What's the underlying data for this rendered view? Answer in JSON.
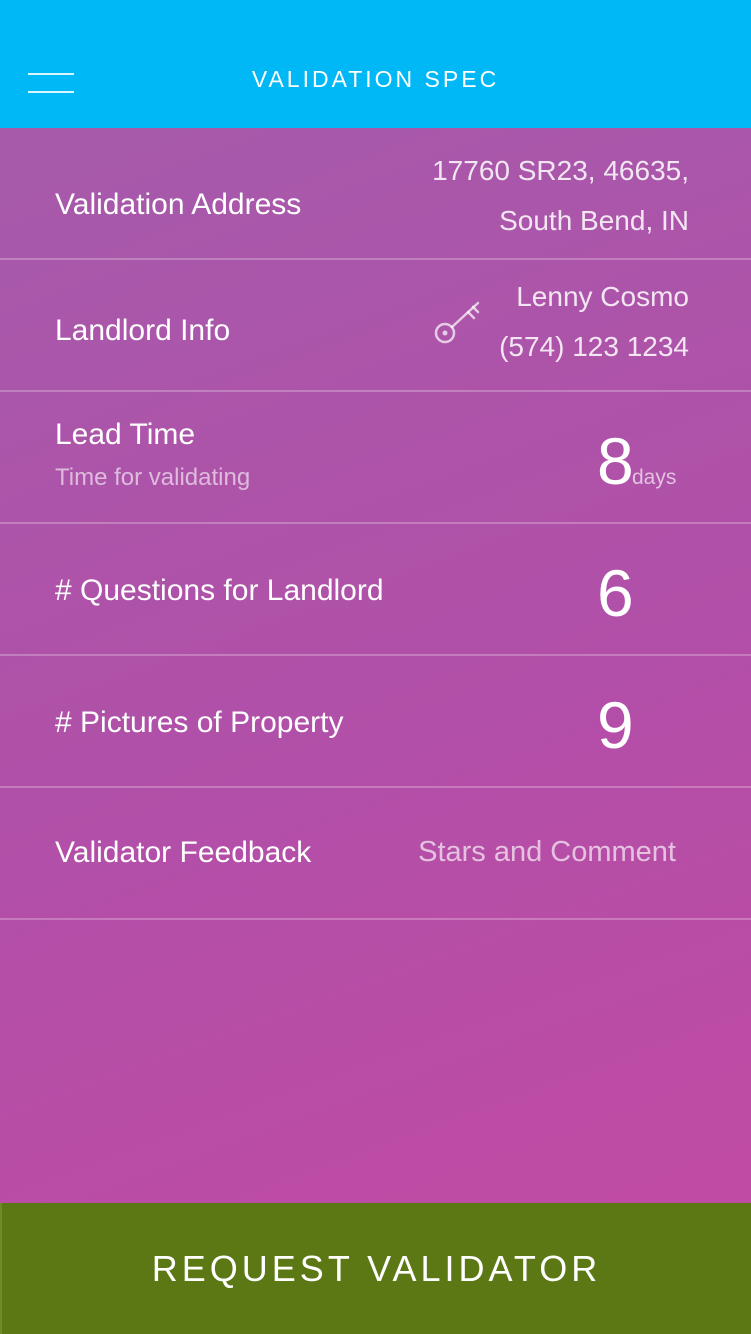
{
  "header": {
    "title": "VALIDATION SPEC"
  },
  "rows": {
    "address": {
      "label": "Validation Address",
      "line1": "17760 SR23, 46635,",
      "line2": "South Bend, IN"
    },
    "landlord": {
      "label": "Landlord Info",
      "icon": "key-icon",
      "name": "Lenny Cosmo",
      "phone": "(574) 123 1234"
    },
    "lead_time": {
      "label": "Lead Time",
      "sublabel": "Time for validating",
      "value": "8",
      "unit": "days"
    },
    "questions": {
      "label": "# Questions for Landlord",
      "value": "6"
    },
    "pictures": {
      "label": "# Pictures of Property",
      "value": "9"
    },
    "feedback": {
      "label": "Validator Feedback",
      "value": "Stars and Comment"
    }
  },
  "cta": {
    "label": "REQUEST VALIDATOR"
  },
  "colors": {
    "header": "#00b8f6",
    "cta": "#5c7815",
    "background_start": "#a45cab",
    "background_end": "#c34aa3"
  }
}
